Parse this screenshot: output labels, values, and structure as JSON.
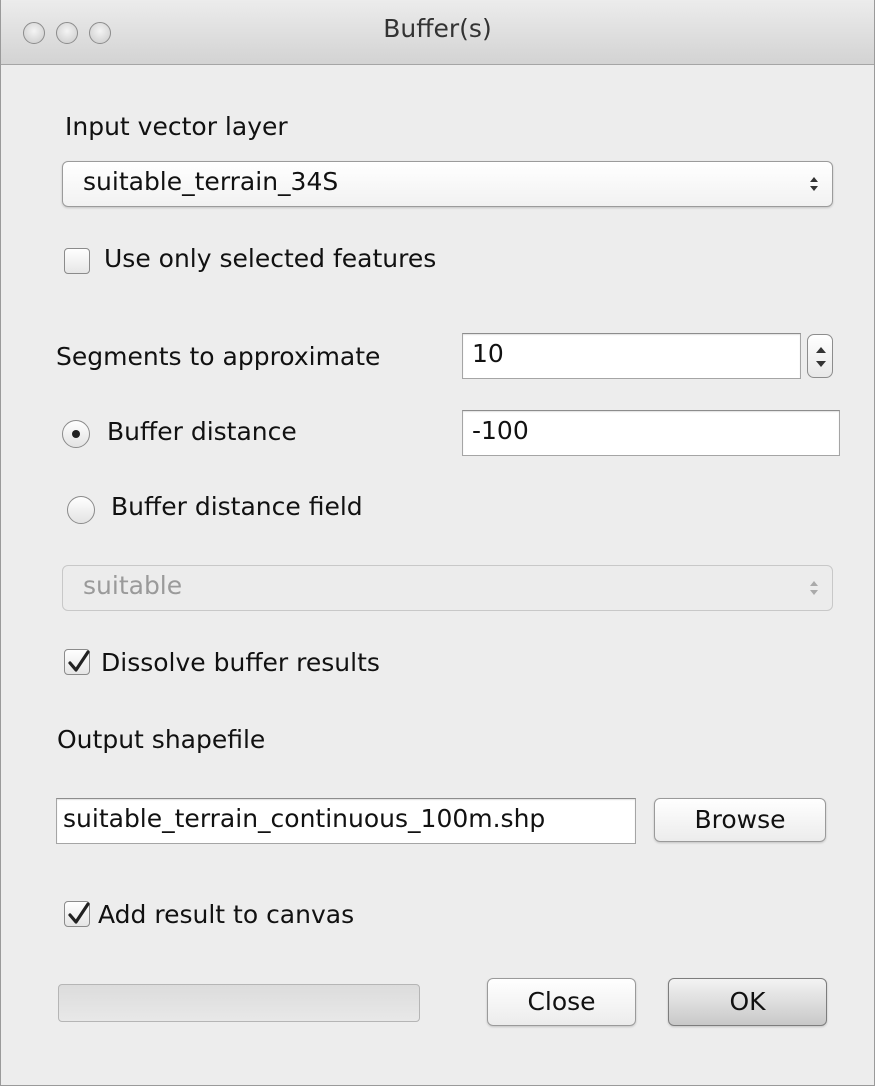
{
  "window": {
    "title": "Buffer(s)"
  },
  "input_layer": {
    "label": "Input vector layer",
    "selected": "suitable_terrain_34S"
  },
  "use_selected": {
    "label": "Use only selected features",
    "checked": false
  },
  "segments": {
    "label": "Segments to approximate",
    "value": "10"
  },
  "buffer_distance": {
    "label": "Buffer distance",
    "value": "-100",
    "selected": true
  },
  "buffer_distance_field": {
    "label": "Buffer distance field",
    "selected_field": "suitable",
    "selected": false
  },
  "dissolve": {
    "label": "Dissolve buffer results",
    "checked": true
  },
  "output": {
    "label": "Output shapefile",
    "path": "suitable_terrain_continuous_100m.shp",
    "browse_label": "Browse"
  },
  "add_result": {
    "label": "Add result to canvas",
    "checked": true
  },
  "progress": {
    "value": 0
  },
  "buttons": {
    "close": "Close",
    "ok": "OK"
  }
}
